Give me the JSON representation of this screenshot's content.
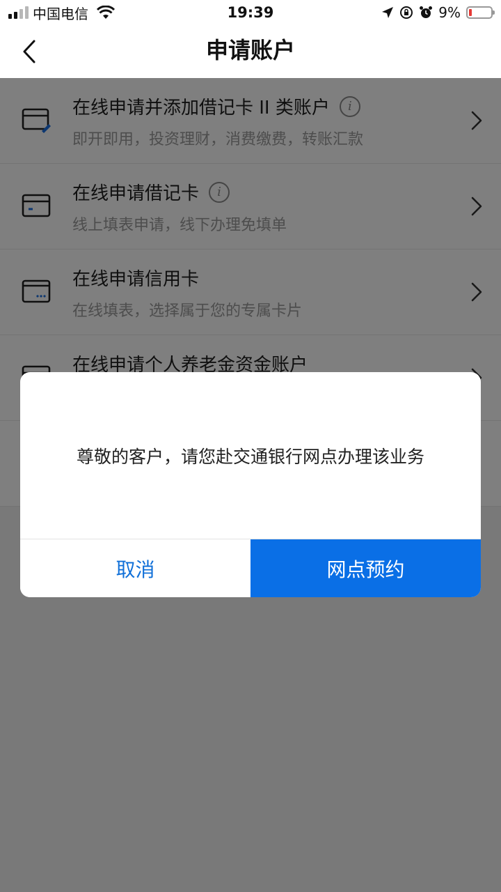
{
  "status_bar": {
    "carrier": "中国电信",
    "time": "19:39",
    "battery_percent": "9%",
    "battery_level": 0.09,
    "icons": [
      "signal-icon",
      "wifi-icon",
      "location-arrow-icon",
      "orientation-lock-icon",
      "alarm-icon",
      "battery-icon"
    ]
  },
  "nav": {
    "title": "申请账户",
    "back_icon": "chevron-left-icon"
  },
  "list": {
    "items": [
      {
        "title": "在线申请并添加借记卡 II 类账户",
        "subtitle": "即开即用，投资理财，消费缴费，转账汇款",
        "has_info": true,
        "icon": "card-edit-icon"
      },
      {
        "title": "在线申请借记卡",
        "subtitle": "线上填表申请，线下办理免填单",
        "has_info": true,
        "icon": "debit-card-icon"
      },
      {
        "title": "在线申请信用卡",
        "subtitle": "在线填表，选择属于您的专属卡片",
        "has_info": false,
        "icon": "credit-card-icon"
      },
      {
        "title": "在线申请个人养老金资金账户",
        "subtitle": "",
        "has_info": false,
        "icon": "pension-card-icon"
      }
    ]
  },
  "dialog": {
    "message": "尊敬的客户，请您赴交通银行网点办理该业务",
    "cancel_label": "取消",
    "confirm_label": "网点预约"
  },
  "colors": {
    "primary": "#0a6fe6",
    "cancel_text": "#0f6fd8",
    "overlay": "rgba(0,0,0,0.5)",
    "battery_low": "#e53935"
  }
}
